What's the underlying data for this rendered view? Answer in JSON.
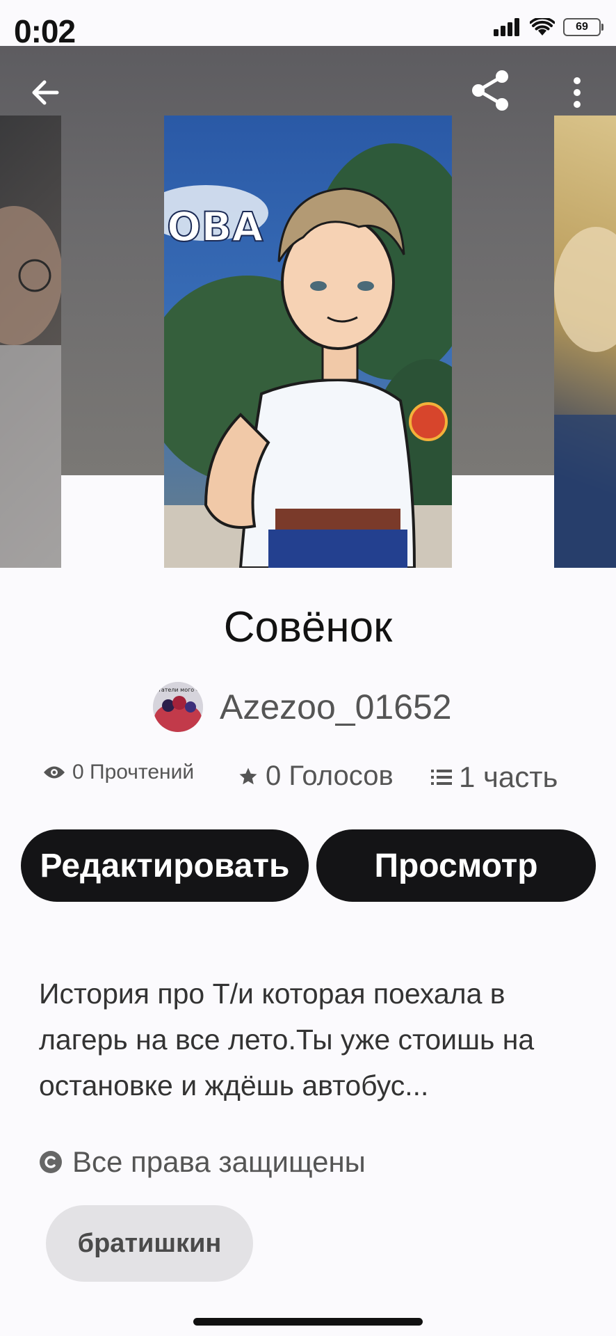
{
  "status_bar": {
    "time": "0:02",
    "battery": "69"
  },
  "story": {
    "title": "Совёнок",
    "author": "Azezoo_01652",
    "avatar_text": "Читатели мого ФФ",
    "cover_text": "ОВА",
    "stats": {
      "reads": "0 Прочтений",
      "votes": "0 Голосов",
      "parts": "1 часть"
    },
    "actions": {
      "edit": "Редактировать",
      "view": "Просмотр"
    },
    "description": "История про Т/и которая поехала в лагерь на все лето.Ты уже стоишь на остановке и ждёшь автобус...",
    "rights": "Все права защищены",
    "tags": [
      "братишкин"
    ]
  },
  "icons": {
    "back": "arrow-left-icon",
    "share": "share-icon",
    "more": "more-vertical-icon",
    "reads": "eye-icon",
    "votes": "star-icon",
    "parts": "list-icon",
    "rights": "copyright-icon"
  },
  "colors": {
    "button_bg": "#141416",
    "tag_bg": "#e3e2e5",
    "page_bg": "#fbfafd"
  }
}
